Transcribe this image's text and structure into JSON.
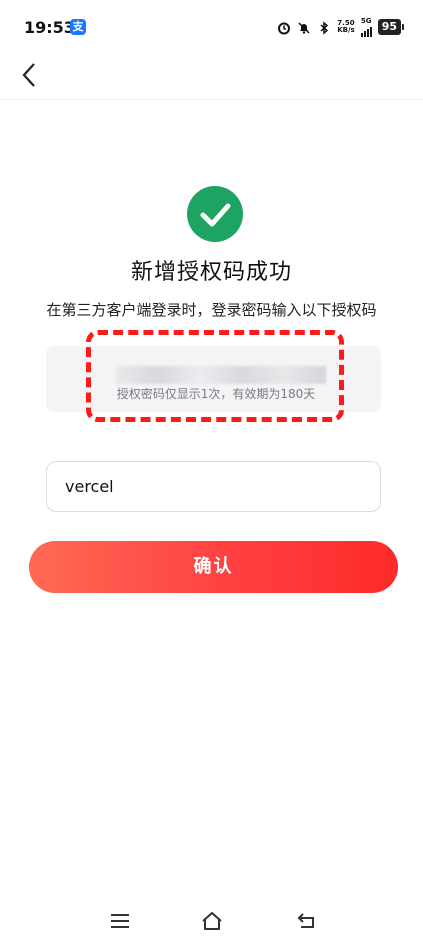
{
  "status_bar": {
    "time": "19:53",
    "app_badge": "支",
    "net_speed_value": "7.50",
    "net_speed_unit": "KB/s",
    "network_type": "5G",
    "battery": "95"
  },
  "page": {
    "title": "新增授权码成功",
    "subtitle": "在第三方客户端登录时，登录密码输入以下授权码",
    "code_note": "授权密码仅显示1次，有效期为180天",
    "code_value": "",
    "name_input_value": "vercel",
    "confirm_label": "确认"
  },
  "colors": {
    "success_green": "#1ea462",
    "accent_red": "#ff4040",
    "annotation_red": "#ff1a1a"
  },
  "icons": {
    "back": "chevron-left-icon",
    "success": "check-circle-icon",
    "menu": "menu-icon",
    "home": "home-icon",
    "return": "return-icon"
  }
}
